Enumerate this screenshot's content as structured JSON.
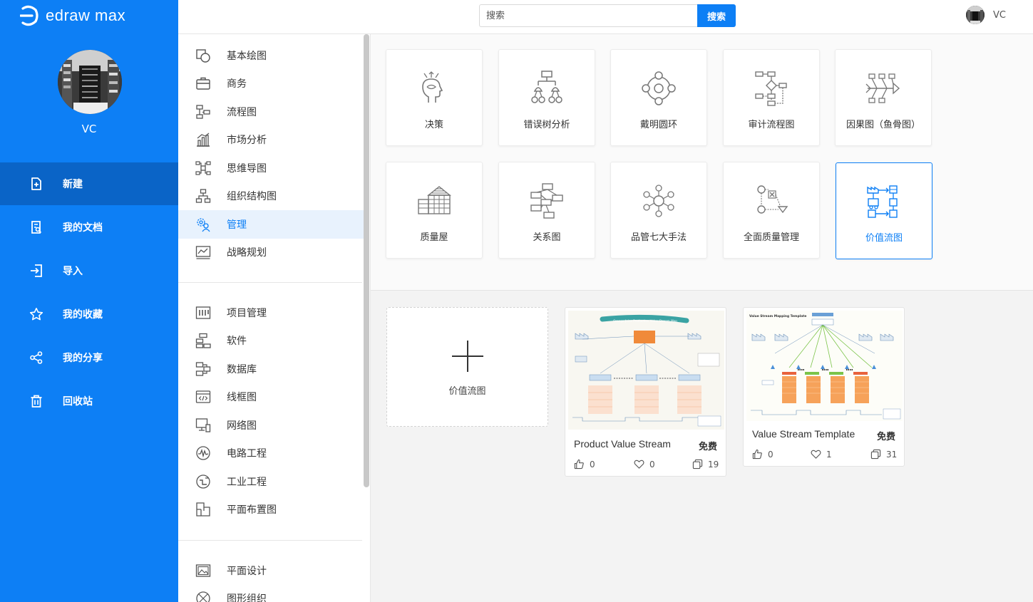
{
  "app": {
    "logo_text": "edraw max",
    "username": "VC"
  },
  "nav": [
    {
      "label": "新建",
      "icon": "new-file-icon"
    },
    {
      "label": "我的文档",
      "icon": "documents-icon"
    },
    {
      "label": "导入",
      "icon": "import-icon"
    },
    {
      "label": "我的收藏",
      "icon": "star-icon"
    },
    {
      "label": "我的分享",
      "icon": "share-icon"
    },
    {
      "label": "回收站",
      "icon": "trash-icon"
    }
  ],
  "search": {
    "placeholder": "搜索",
    "button": "搜索"
  },
  "topbar": {
    "user": "VC"
  },
  "categories": {
    "group1": [
      "基本绘图",
      "商务",
      "流程图",
      "市场分析",
      "思维导图",
      "组织结构图",
      "管理",
      "战略规划"
    ],
    "group2": [
      "项目管理",
      "软件",
      "数据库",
      "线框图",
      "网络图",
      "电路工程",
      "工业工程",
      "平面布置图"
    ],
    "group3": [
      "平面设计",
      "图形组织"
    ]
  },
  "subcategories": [
    "决策",
    "错误树分析",
    "戴明圆环",
    "审计流程图",
    "因果图（鱼骨图）",
    "质量屋",
    "关系图",
    "品管七大手法",
    "全面质量管理",
    "价值流图"
  ],
  "new_card": {
    "label": "价值流图"
  },
  "templates": [
    {
      "name": "Product Value Stream",
      "price": "免费",
      "likes": "0",
      "favorites": "0",
      "copies": "19",
      "thumb_title": "Orange Juice Production Value Stream Map"
    },
    {
      "name": "Value Stream Template",
      "price": "免费",
      "likes": "0",
      "favorites": "1",
      "copies": "31",
      "thumb_title": "Value Stream Mapping Template"
    }
  ],
  "colors": {
    "primary": "#0d7ff5",
    "primary_dark": "#0a64c7"
  }
}
